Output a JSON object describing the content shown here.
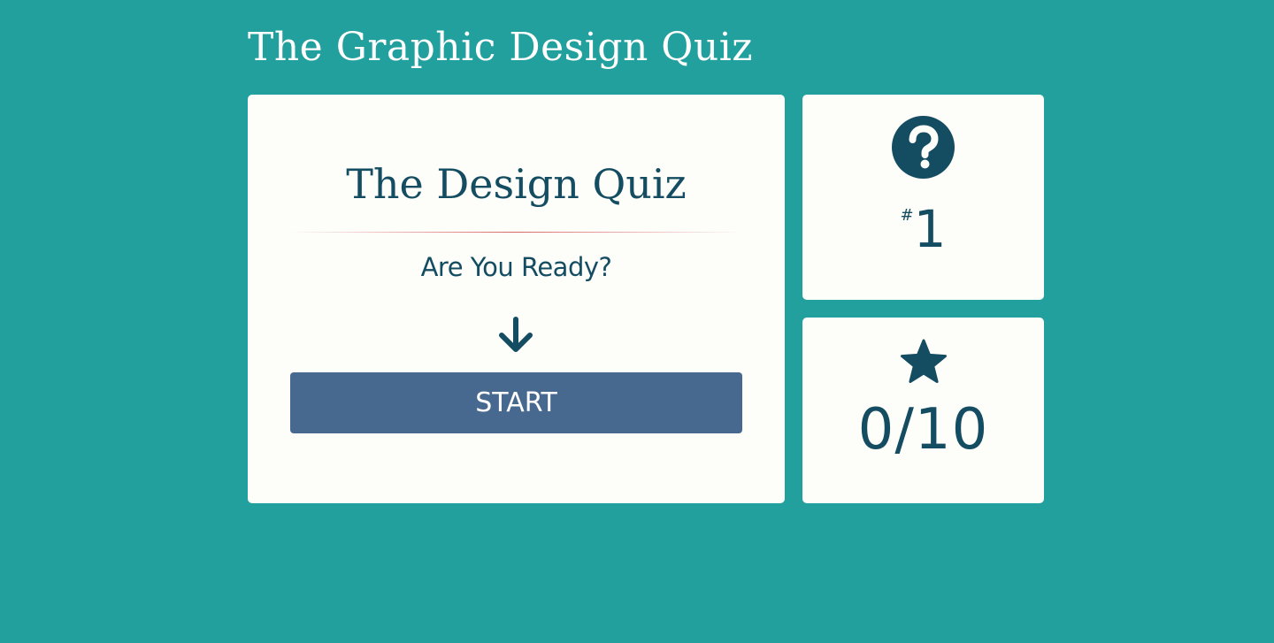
{
  "header": {
    "title": "The Graphic Design Quiz"
  },
  "main_card": {
    "heading": "The Design Quiz",
    "prompt": "Are You Ready?",
    "arrow_icon": "arrow-down-icon",
    "start_label": "START"
  },
  "question_counter": {
    "icon": "question-circle-icon",
    "prefix": "#",
    "number": "1"
  },
  "score": {
    "icon": "star-icon",
    "value": "0/10"
  },
  "colors": {
    "background": "#21a09e",
    "card": "#fdfef9",
    "text_dark": "#144c62",
    "button": "#48698f",
    "divider_accent": "#d45757"
  }
}
